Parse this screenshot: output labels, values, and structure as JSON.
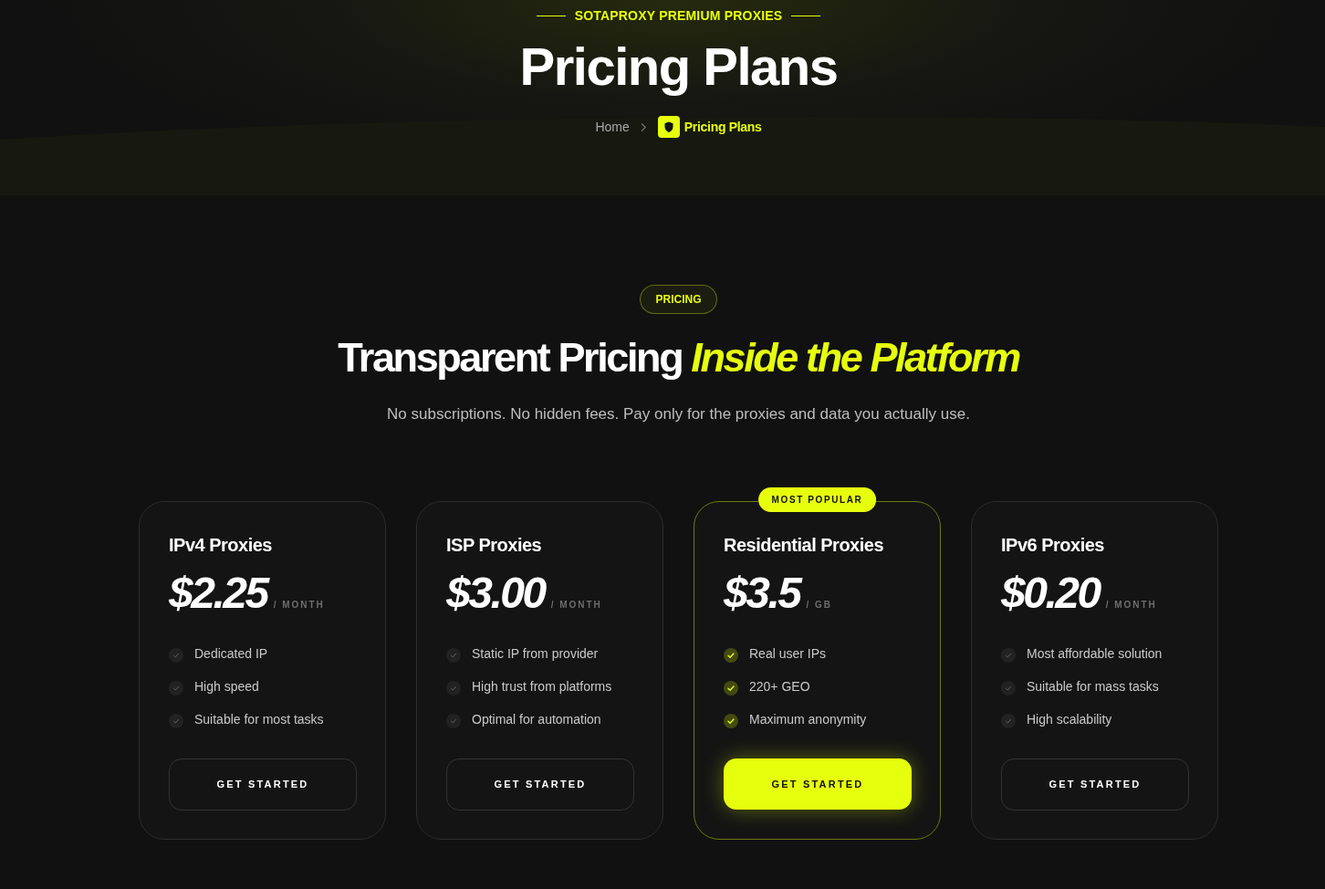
{
  "hero": {
    "eyebrow": "SOTAPROXY PREMIUM PROXIES",
    "title": "Pricing Plans",
    "breadcrumb": [
      {
        "label": "Home",
        "current": false
      },
      {
        "label": "Pricing Plans",
        "current": true
      }
    ]
  },
  "section": {
    "badge": "PRICING",
    "heading": "Transparent Pricing *Inside the Platform*",
    "subtitle": "No subscriptions. No hidden fees. Pay only for the proxies and data you actually use."
  },
  "plans": [
    {
      "name": "IPv4 Proxies",
      "price": "$2.25",
      "unit": "/ MONTH",
      "featured": false,
      "features": [
        "Dedicated IP",
        "High speed",
        "Suitable for most tasks"
      ],
      "button": "GET STARTED"
    },
    {
      "name": "ISP Proxies",
      "price": "$3.00",
      "unit": "/ MONTH",
      "featured": false,
      "features": [
        "Static IP from provider",
        "High trust from platforms",
        "Optimal for automation"
      ],
      "button": "GET STARTED"
    },
    {
      "name": "Residential Proxies",
      "price": "$3.5",
      "unit": "/ GB",
      "featured": true,
      "ribbon": "MOST POPULAR",
      "features": [
        "Real user IPs",
        "220+ GEO",
        "Maximum anonymity"
      ],
      "button": "GET STARTED"
    },
    {
      "name": "IPv6 Proxies",
      "price": "$0.20",
      "unit": "/ MONTH",
      "featured": false,
      "features": [
        "Most affordable solution",
        "Suitable for mass tasks",
        "High scalability"
      ],
      "button": "GET STARTED"
    }
  ]
}
